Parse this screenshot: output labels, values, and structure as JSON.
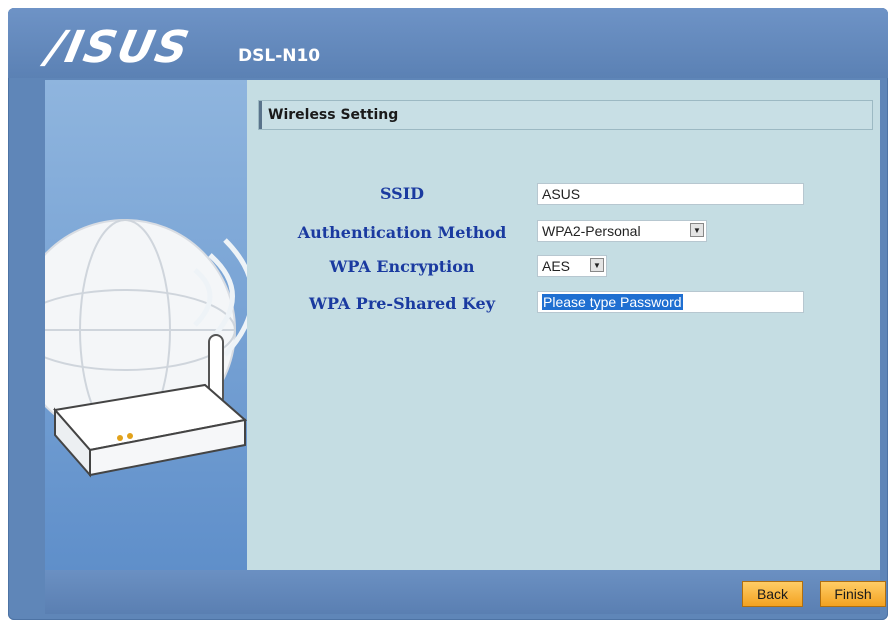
{
  "header": {
    "brand": "/ISUS",
    "model": "DSL-N10"
  },
  "section": {
    "title": "Wireless Setting"
  },
  "form": {
    "ssid_label": "SSID",
    "ssid_value": "ASUS",
    "auth_label": "Authentication Method",
    "auth_value": "WPA2-Personal",
    "encryption_label": "WPA Encryption",
    "encryption_value": "AES",
    "psk_label": "WPA Pre-Shared Key",
    "psk_value": "Please type Password"
  },
  "footer": {
    "back_label": "Back",
    "finish_label": "Finish"
  },
  "colors": {
    "frame": "#5f86b8",
    "content_bg": "#c5dde3",
    "label_text": "#1a3aa0",
    "button": "#f3a221"
  },
  "icons": {
    "hero_illustration": "router-globe-illustration",
    "dropdown_arrow": "chevron-down-icon"
  }
}
